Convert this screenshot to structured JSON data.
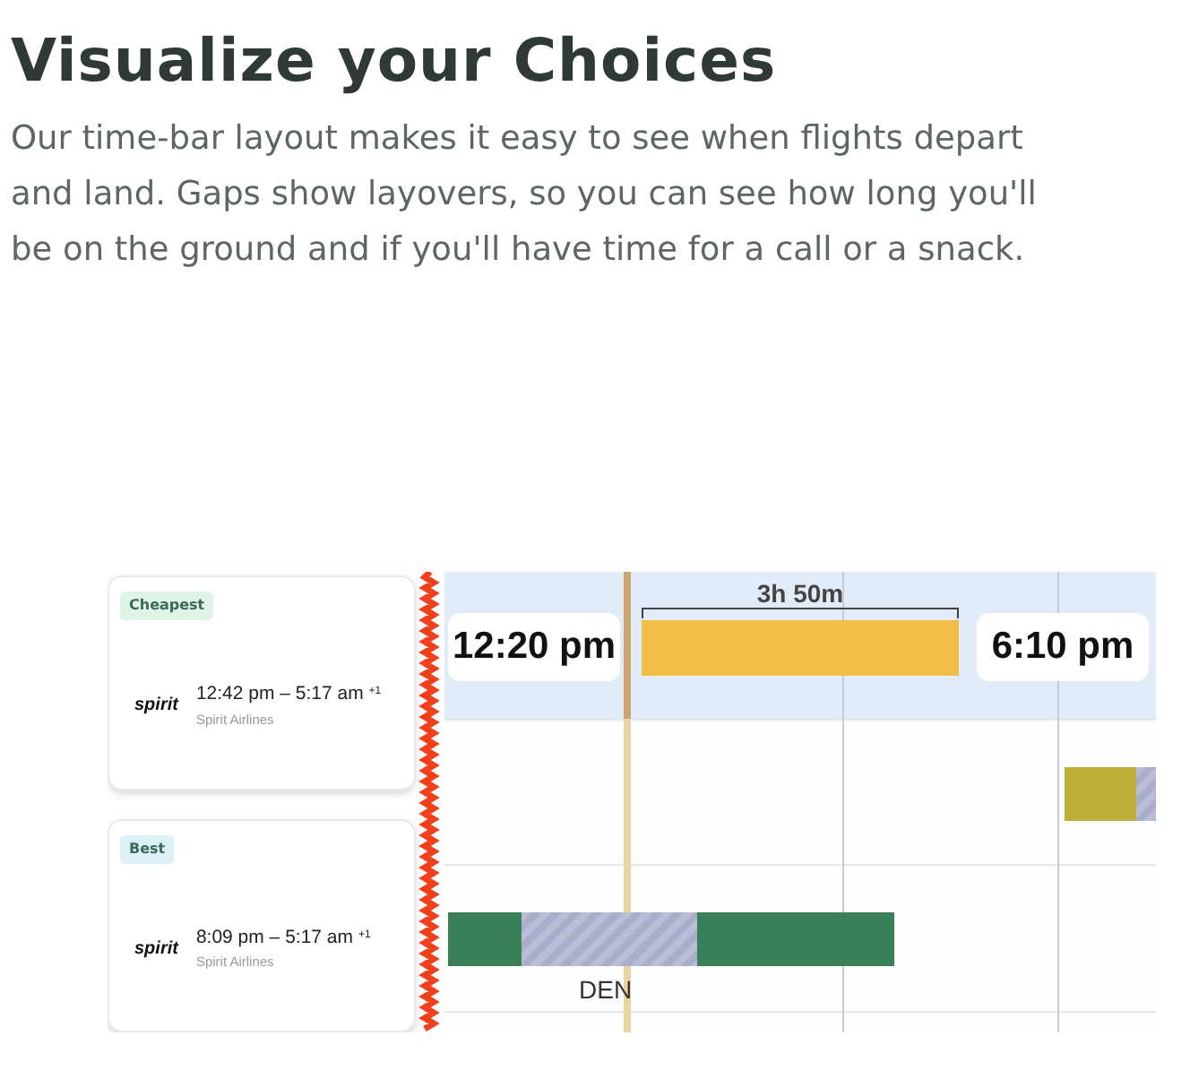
{
  "heading": "Visualize your Choices",
  "intro": "Our time-bar layout makes it easy to see when flights depart and land. Gaps show layovers, so you can see how long you'll be on the ground and if you'll have time for a call or a snack.",
  "results": [
    {
      "badge": "Cheapest",
      "color": "#dff3e6",
      "logo": "spirit",
      "times": "12:42 pm – 5:17 am",
      "day_offset": "+1",
      "airline": "Spirit Airlines"
    },
    {
      "badge": "Best",
      "color": "#dcf0f8",
      "logo": "spirit",
      "times": "8:09 pm – 5:17 am",
      "day_offset": "+1",
      "airline": "Spirit Airlines"
    }
  ],
  "timeline": {
    "depart": "12:20 pm",
    "duration": "3h 50m",
    "arrive": "6:10 pm",
    "color": "#f4bd47",
    "rows": [
      {
        "color": "#bfae3a",
        "segments": [
          {
            "kind": "flight"
          },
          {
            "kind": "layover"
          }
        ]
      },
      {
        "color": "#3a8057",
        "segments": [
          {
            "kind": "flight"
          },
          {
            "kind": "layover",
            "label": "DEN"
          },
          {
            "kind": "flight"
          }
        ]
      }
    ]
  }
}
